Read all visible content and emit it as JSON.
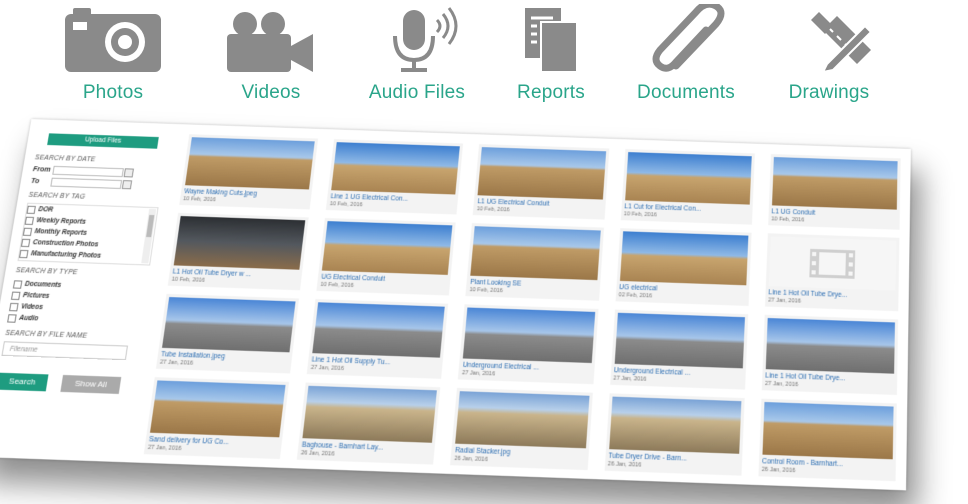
{
  "categories": [
    {
      "label": "Photos",
      "icon": "camera-icon"
    },
    {
      "label": "Videos",
      "icon": "video-camera-icon"
    },
    {
      "label": "Audio Files",
      "icon": "microphone-icon"
    },
    {
      "label": "Reports",
      "icon": "report-pages-icon"
    },
    {
      "label": "Documents",
      "icon": "paperclip-icon"
    },
    {
      "label": "Drawings",
      "icon": "ruler-pencil-icon"
    }
  ],
  "colors": {
    "accent": "#2aa58a",
    "button": "#1e9c80",
    "icon_gray": "#8a8a8a",
    "link": "#2e6fb3"
  },
  "sidebar": {
    "upload_label": "Upload Files",
    "search_by_date": "SEARCH BY DATE",
    "from_label": "From",
    "to_label": "To",
    "search_by_tag": "SEARCH BY TAG",
    "tags": [
      "DOR",
      "Weekly Reports",
      "Monthly Reports",
      "Construction Photos",
      "Manufacturing Photos"
    ],
    "search_by_type": "SEARCH BY TYPE",
    "types": [
      "Documents",
      "Pictures",
      "Videos",
      "Audio"
    ],
    "search_by_file_name": "SEARCH BY FILE NAME",
    "filename_placeholder": "Filename",
    "search_label": "Search",
    "show_all_label": "Show All"
  },
  "files": [
    {
      "title": "Wayne Making Cuts.jpeg",
      "date": "10 Feb, 2016",
      "style": "dirt"
    },
    {
      "title": "Line 1 UG Electrical Con...",
      "date": "10 Feb, 2016",
      "style": "sky"
    },
    {
      "title": "L1 UG Electrical Conduit",
      "date": "10 Feb, 2016",
      "style": "dirt"
    },
    {
      "title": "L1 Cut for Electrical Con...",
      "date": "10 Feb, 2016",
      "style": "sky"
    },
    {
      "title": "L1 UG Conduit",
      "date": "10 Feb, 2016",
      "style": "dirt"
    },
    {
      "title": "L1 Hot Oil Tube Dryer w ...",
      "date": "10 Feb, 2016",
      "style": "dark"
    },
    {
      "title": "UG Electrical Conduit",
      "date": "10 Feb, 2016",
      "style": "sky"
    },
    {
      "title": "Plant Looking SE",
      "date": "10 Feb, 2016",
      "style": "dirt"
    },
    {
      "title": "UG electrical",
      "date": "02 Feb, 2016",
      "style": "sky"
    },
    {
      "title": "Line 1 Hot Oil Tube Drye...",
      "date": "27 Jan, 2016",
      "style": "video"
    },
    {
      "title": "Tube Installation.jpeg",
      "date": "27 Jan, 2016",
      "style": "yard"
    },
    {
      "title": "Line 1 Hot Oil Supply Tu...",
      "date": "27 Jan, 2016",
      "style": "yard"
    },
    {
      "title": "Underground Electrical ...",
      "date": "27 Jan, 2016",
      "style": "yard"
    },
    {
      "title": "Underground Electrical ...",
      "date": "27 Jan, 2016",
      "style": "yard"
    },
    {
      "title": "Line 1 Hot Oil Tube Drye...",
      "date": "27 Jan, 2016",
      "style": "yard"
    },
    {
      "title": "Sand delivery for UG Co...",
      "date": "27 Jan, 2016",
      "style": "dirt"
    },
    {
      "title": "Baghouse - Barnhart Lay...",
      "date": "26 Jan, 2016",
      "style": "beige"
    },
    {
      "title": "Radial Stacker.jpg",
      "date": "26 Jan, 2016",
      "style": "beige"
    },
    {
      "title": "Tube Dryer Drive - Barn...",
      "date": "26 Jan, 2016",
      "style": "beige"
    },
    {
      "title": "Control Room - Barnhart...",
      "date": "26 Jan, 2016",
      "style": "dirt"
    }
  ]
}
